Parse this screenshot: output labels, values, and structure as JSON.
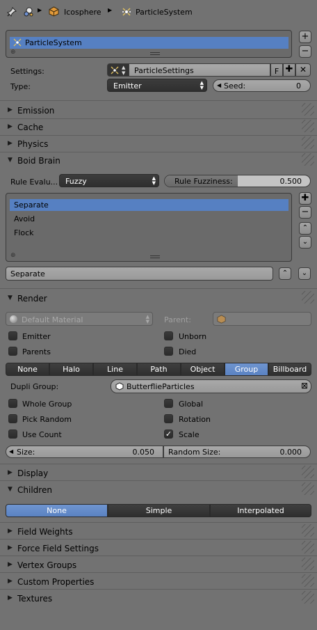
{
  "header": {
    "pin_icon": "pin-icon",
    "breadcrumb": [
      "Icosphere",
      "ParticleSystem"
    ]
  },
  "particle_list": {
    "items": [
      "ParticleSystem"
    ],
    "selected_index": 0
  },
  "settings": {
    "settings_label": "Settings:",
    "settings_value": "ParticleSettings",
    "fake_user_label": "F",
    "type_label": "Type:",
    "type_value": "Emitter",
    "seed_label": "Seed:",
    "seed_value": "0"
  },
  "panels_top": [
    {
      "label": "Emission",
      "expanded": false
    },
    {
      "label": "Cache",
      "expanded": false
    },
    {
      "label": "Physics",
      "expanded": false
    }
  ],
  "boid_brain": {
    "label": "Boid Brain",
    "rule_eval_label": "Rule Evalu...",
    "rule_eval_value": "Fuzzy",
    "rule_fuzziness_label": "Rule Fuzziness:",
    "rule_fuzziness_value": "0.500",
    "rule_fuzziness_fraction": 0.5,
    "rules": [
      "Separate",
      "Avoid",
      "Flock"
    ],
    "selected_rule": 0,
    "rule_name": "Separate"
  },
  "render": {
    "label": "Render",
    "material_value": "Default Material",
    "parent_label": "Parent:",
    "emitter_label": "Emitter",
    "unborn_label": "Unborn",
    "parents_label": "Parents",
    "died_label": "Died",
    "render_as": [
      "None",
      "Halo",
      "Line",
      "Path",
      "Object",
      "Group",
      "Billboard"
    ],
    "render_as_active": "Group",
    "dupli_group_label": "Dupli Group:",
    "dupli_group_value": "ButterflieParticles",
    "whole_group_label": "Whole Group",
    "global_label": "Global",
    "pick_random_label": "Pick Random",
    "rotation_label": "Rotation",
    "use_count_label": "Use Count",
    "scale_label": "Scale",
    "scale_checked": true,
    "size_label": "Size:",
    "size_value": "0.050",
    "random_size_label": "Random Size:",
    "random_size_value": "0.000"
  },
  "display": {
    "label": "Display"
  },
  "children": {
    "label": "Children",
    "options": [
      "None",
      "Simple",
      "Interpolated"
    ],
    "active": "None"
  },
  "panels_bottom": [
    {
      "label": "Field Weights"
    },
    {
      "label": "Force Field Settings"
    },
    {
      "label": "Vertex Groups"
    },
    {
      "label": "Custom Properties"
    },
    {
      "label": "Textures"
    }
  ],
  "colors": {
    "background": "#727272",
    "selection": "#5680c2",
    "dark_widget": "#333333"
  }
}
